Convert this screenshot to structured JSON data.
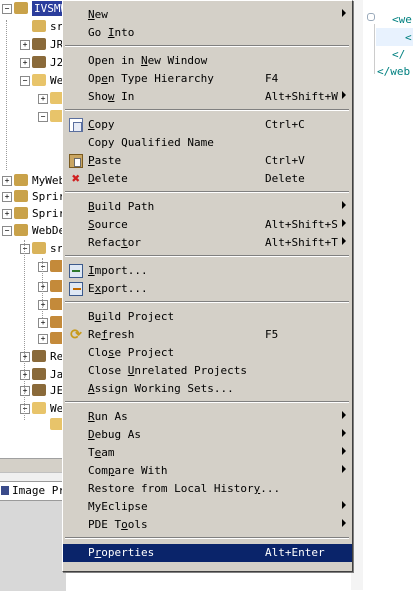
{
  "tree": {
    "rows": [
      {
        "label": "IVSMW",
        "selected": true,
        "expander": "−",
        "icon": "project-icon"
      },
      {
        "label": "sr",
        "selected": false,
        "expander": "",
        "icon": "source-folder-icon"
      },
      {
        "label": "JR",
        "selected": false,
        "expander": "+",
        "icon": "library-icon"
      },
      {
        "label": "J2",
        "selected": false,
        "expander": "+",
        "icon": "library-icon"
      },
      {
        "label": "We",
        "selected": false,
        "expander": "−",
        "icon": "folder-icon"
      },
      {
        "label": "",
        "selected": false,
        "expander": "+",
        "icon": "folder-icon"
      },
      {
        "label": "",
        "selected": false,
        "expander": "−",
        "icon": "folder-icon"
      },
      {
        "label": "",
        "selected": false,
        "expander": "",
        "icon": "folder-icon"
      },
      {
        "label": "",
        "selected": false,
        "expander": "",
        "icon": "jsp-file-icon"
      },
      {
        "label": "MyWeb",
        "selected": false,
        "expander": "+",
        "icon": "project-icon"
      },
      {
        "label": "Sprir",
        "selected": false,
        "expander": "+",
        "icon": "project-icon"
      },
      {
        "label": "Sprir",
        "selected": false,
        "expander": "+",
        "icon": "project-icon"
      },
      {
        "label": "WebDe",
        "selected": false,
        "expander": "−",
        "icon": "project-icon"
      },
      {
        "label": "sr",
        "selected": false,
        "expander": "−",
        "icon": "source-folder-icon"
      },
      {
        "label": "",
        "selected": false,
        "expander": "−",
        "icon": "package-icon"
      },
      {
        "label": "",
        "selected": false,
        "expander": "+",
        "icon": "package-icon"
      },
      {
        "label": "",
        "selected": false,
        "expander": "+",
        "icon": "package-icon"
      },
      {
        "label": "",
        "selected": false,
        "expander": "+",
        "icon": "package-icon"
      },
      {
        "label": "",
        "selected": false,
        "expander": "+",
        "icon": "package-icon"
      },
      {
        "label": "Re",
        "selected": false,
        "expander": "+",
        "icon": "library-icon"
      },
      {
        "label": "Ja",
        "selected": false,
        "expander": "+",
        "icon": "library-icon"
      },
      {
        "label": "JE",
        "selected": false,
        "expander": "+",
        "icon": "library-icon"
      },
      {
        "label": "We",
        "selected": false,
        "expander": "−",
        "icon": "folder-icon"
      },
      {
        "label": "",
        "selected": false,
        "expander": "",
        "icon": "folder-icon"
      }
    ]
  },
  "bottom_tab": {
    "label": "Image Pro"
  },
  "editor": {
    "lines": [
      "<we",
      "<",
      "</",
      "</web"
    ]
  },
  "menu": {
    "groups": [
      [
        {
          "label": "New",
          "u": "N",
          "accel": "",
          "submenu": true,
          "icon": ""
        },
        {
          "label": "Go Into",
          "u": "I",
          "accel": "",
          "submenu": false,
          "icon": ""
        }
      ],
      [
        {
          "label": "Open in New Window",
          "u": "N",
          "accel": "",
          "submenu": false,
          "icon": ""
        },
        {
          "label": "Open Type Hierarchy",
          "u": "e",
          "accel": "F4",
          "submenu": false,
          "icon": ""
        },
        {
          "label": "Show In",
          "u": "w",
          "accel": "Alt+Shift+W",
          "submenu": true,
          "icon": ""
        }
      ],
      [
        {
          "label": "Copy",
          "u": "C",
          "accel": "Ctrl+C",
          "submenu": false,
          "icon": "copy-icon"
        },
        {
          "label": "Copy Qualified Name",
          "u": "",
          "accel": "",
          "submenu": false,
          "icon": ""
        },
        {
          "label": "Paste",
          "u": "P",
          "accel": "Ctrl+V",
          "submenu": false,
          "icon": "paste-icon"
        },
        {
          "label": "Delete",
          "u": "D",
          "accel": "Delete",
          "submenu": false,
          "icon": "delete-icon"
        }
      ],
      [
        {
          "label": "Build Path",
          "u": "B",
          "accel": "",
          "submenu": true,
          "icon": ""
        },
        {
          "label": "Source",
          "u": "S",
          "accel": "Alt+Shift+S",
          "submenu": true,
          "icon": ""
        },
        {
          "label": "Refactor",
          "u": "t",
          "accel": "Alt+Shift+T",
          "submenu": true,
          "icon": ""
        }
      ],
      [
        {
          "label": "Import...",
          "u": "I",
          "accel": "",
          "submenu": false,
          "icon": "import-icon"
        },
        {
          "label": "Export...",
          "u": "x",
          "accel": "",
          "submenu": false,
          "icon": "export-icon"
        }
      ],
      [
        {
          "label": "Build Project",
          "u": "u",
          "accel": "",
          "submenu": false,
          "icon": ""
        },
        {
          "label": "Refresh",
          "u": "f",
          "accel": "F5",
          "submenu": false,
          "icon": "refresh-icon"
        },
        {
          "label": "Close Project",
          "u": "s",
          "accel": "",
          "submenu": false,
          "icon": ""
        },
        {
          "label": "Close Unrelated Projects",
          "u": "U",
          "accel": "",
          "submenu": false,
          "icon": ""
        },
        {
          "label": "Assign Working Sets...",
          "u": "A",
          "accel": "",
          "submenu": false,
          "icon": ""
        }
      ],
      [
        {
          "label": "Run As",
          "u": "R",
          "accel": "",
          "submenu": true,
          "icon": ""
        },
        {
          "label": "Debug As",
          "u": "D",
          "accel": "",
          "submenu": true,
          "icon": ""
        },
        {
          "label": "Team",
          "u": "e",
          "accel": "",
          "submenu": true,
          "icon": ""
        },
        {
          "label": "Compare With",
          "u": "p",
          "accel": "",
          "submenu": true,
          "icon": ""
        },
        {
          "label": "Restore from Local History...",
          "u": "y",
          "accel": "",
          "submenu": false,
          "icon": ""
        },
        {
          "label": "MyEclipse",
          "u": "",
          "accel": "",
          "submenu": true,
          "icon": ""
        },
        {
          "label": "PDE Tools",
          "u": "o",
          "accel": "",
          "submenu": true,
          "icon": ""
        }
      ],
      [
        {
          "label": "Properties",
          "u": "r",
          "accel": "Alt+Enter",
          "submenu": false,
          "icon": "",
          "selected": true
        }
      ]
    ]
  }
}
